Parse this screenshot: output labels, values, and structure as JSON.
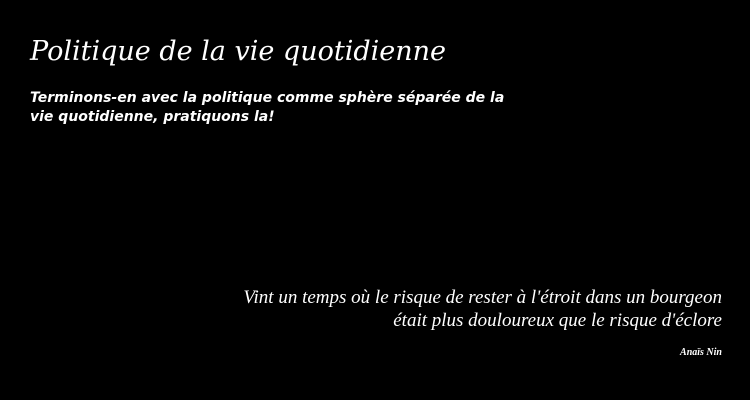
{
  "header": {
    "title": "Politique de la vie quotidienne",
    "tagline": "Terminons-en avec la politique comme sphère séparée de la vie quotidienne, pratiquons la!"
  },
  "quote": {
    "line1": "Vint un temps où le risque de rester à l'étroit dans un bourgeon",
    "line2": "était plus douloureux que le risque d'éclore",
    "author": "Anaïs Nin"
  },
  "colors": {
    "background": "#000000",
    "text": "#ffffff"
  }
}
